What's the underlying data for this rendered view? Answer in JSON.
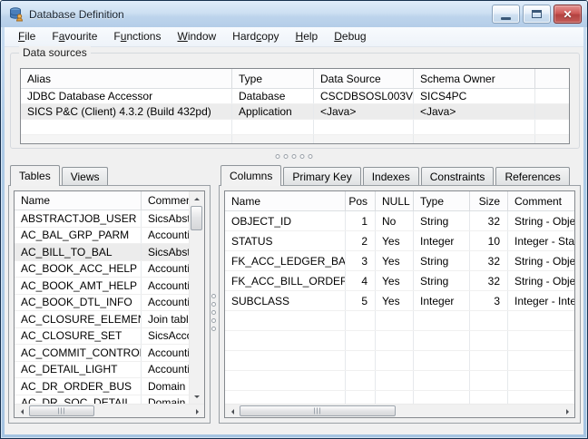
{
  "window": {
    "title": "Database Definition",
    "controls": {
      "minimize": "minimize",
      "maximize": "maximize",
      "close": "✕"
    }
  },
  "menu": [
    {
      "label": "File",
      "u": 0
    },
    {
      "label": "Favourite",
      "u": 1
    },
    {
      "label": "Functions",
      "u": 1
    },
    {
      "label": "Window",
      "u": 0
    },
    {
      "label": "Hardcopy",
      "u": 4
    },
    {
      "label": "Help",
      "u": 0
    },
    {
      "label": "Debug",
      "u": 0
    }
  ],
  "data_sources": {
    "label": "Data sources",
    "headers": [
      "Alias",
      "Type",
      "Data Source",
      "Schema Owner"
    ],
    "rows": [
      {
        "cells": [
          "JDBC Database Accessor",
          "Database",
          "CSCDBSOSL003V",
          "SICS4PC"
        ],
        "selected": false
      },
      {
        "cells": [
          "SICS P&C (Client) 4.3.2  (Build 432pd)",
          "Application",
          "<Java>",
          "<Java>"
        ],
        "selected": true
      },
      {
        "cells": [
          "",
          "",
          "",
          ""
        ],
        "selected": false
      },
      {
        "cells": [
          "",
          "",
          "",
          ""
        ],
        "selected": false
      }
    ]
  },
  "tables_panel": {
    "tabs": [
      "Tables",
      "Views"
    ],
    "active_tab": "Tables",
    "headers": [
      "Name",
      "Comment"
    ],
    "rows": [
      {
        "name": "ABSTRACTJOB_USER",
        "comment": "SicsAbstra",
        "selected": false
      },
      {
        "name": "AC_BAL_GRP_PARM",
        "comment": "Accountin",
        "selected": false
      },
      {
        "name": "AC_BILL_TO_BAL",
        "comment": "SicsAbstra",
        "selected": true
      },
      {
        "name": "AC_BOOK_ACC_HELP",
        "comment": "Accountin",
        "selected": false
      },
      {
        "name": "AC_BOOK_AMT_HELP",
        "comment": "Accountin",
        "selected": false
      },
      {
        "name": "AC_BOOK_DTL_INFO",
        "comment": "Accountin",
        "selected": false
      },
      {
        "name": "AC_CLOSURE_ELEMENT",
        "comment": "Join table",
        "selected": false
      },
      {
        "name": "AC_CLOSURE_SET",
        "comment": "SicsAccou",
        "selected": false
      },
      {
        "name": "AC_COMMIT_CONTROL",
        "comment": "Accountin",
        "selected": false
      },
      {
        "name": "AC_DETAIL_LIGHT",
        "comment": "Accountin",
        "selected": false
      },
      {
        "name": "AC_DR_ORDER_BUS",
        "comment": "Domain re",
        "selected": false
      },
      {
        "name": "AC_DR_SOC_DETAIL",
        "comment": "Domain re",
        "selected": false
      }
    ]
  },
  "columns_panel": {
    "tabs": [
      "Columns",
      "Primary Key",
      "Indexes",
      "Constraints",
      "References"
    ],
    "active_tab": "Columns",
    "headers": [
      "Name",
      "Pos",
      "NULL",
      "Type",
      "Size",
      "Comment"
    ],
    "rows": [
      {
        "name": "OBJECT_ID",
        "pos": "1",
        "null": "No",
        "type": "String",
        "size": "32",
        "comment": "String - Object Id"
      },
      {
        "name": "STATUS",
        "pos": "2",
        "null": "Yes",
        "type": "Integer",
        "size": "10",
        "comment": "Integer - Status"
      },
      {
        "name": "FK_ACC_LEDGER_BAL",
        "pos": "3",
        "null": "Yes",
        "type": "String",
        "size": "32",
        "comment": "String - Object Id"
      },
      {
        "name": "FK_ACC_BILL_ORDER",
        "pos": "4",
        "null": "Yes",
        "type": "String",
        "size": "32",
        "comment": "String - Object Id"
      },
      {
        "name": "SUBCLASS",
        "pos": "5",
        "null": "Yes",
        "type": "Integer",
        "size": "3",
        "comment": "Integer - Interna"
      }
    ],
    "empty_rows": 5
  },
  "colors": {
    "titlebar_blue": "#cde0f2",
    "frame_blue": "#a5c4e2",
    "selection_gray": "#ececec",
    "close_red": "#c4504d"
  }
}
